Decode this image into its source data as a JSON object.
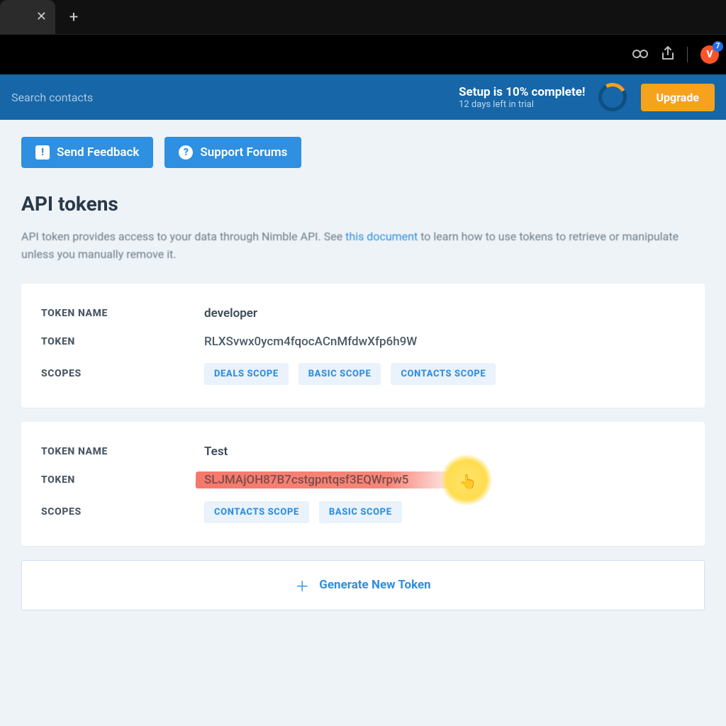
{
  "browser": {
    "extension_badge": "7"
  },
  "header": {
    "search_placeholder": "Search contacts",
    "setup_title": "Setup is 10% complete!",
    "setup_sub": "12 days left in trial",
    "upgrade_label": "Upgrade"
  },
  "actions": {
    "feedback": "Send Feedback",
    "forums": "Support Forums"
  },
  "page": {
    "title": "API tokens",
    "lead_pre": "API token provides access to your data through Nimble API. See ",
    "lead_link": "this document",
    "lead_post": " to learn how to use tokens to retrieve or manipulate unless you manually remove it."
  },
  "labels": {
    "token_name": "TOKEN NAME",
    "token": "TOKEN",
    "scopes": "SCOPES"
  },
  "tokens": [
    {
      "name": "developer",
      "value": "RLXSvwx0ycm4fqocACnMfdwXfp6h9W",
      "scopes": [
        "DEALS SCOPE",
        "BASIC SCOPE",
        "CONTACTS SCOPE"
      ]
    },
    {
      "name": "Test",
      "value": "SLJMAjOH87B7cstgpntqsf3EQWrpw5",
      "scopes": [
        "CONTACTS SCOPE",
        "BASIC SCOPE"
      ]
    }
  ],
  "generate_label": "Generate New Token"
}
